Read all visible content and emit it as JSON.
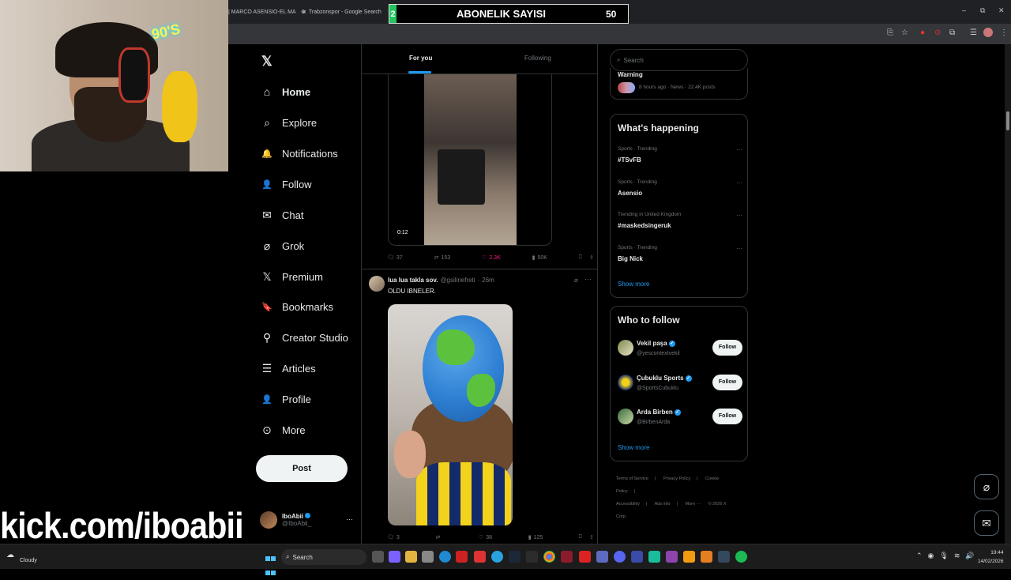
{
  "browser": {
    "tabs": [
      {
        "label": "| MARCO ASENSIO-EL MA",
        "close": "×"
      },
      {
        "label": "Trabzonspor - Google Search",
        "close": "×"
      }
    ],
    "window_controls": {
      "minimize": "–",
      "restore": "⧉",
      "close": "✕"
    }
  },
  "overlay": {
    "sub_counter": {
      "title": "ABONELIK SAYISI",
      "left_value": "2",
      "count": "50"
    },
    "kick_url": "kick.com/iboabii",
    "webcam_sign": "90'S"
  },
  "sidebar": {
    "logo": "𝕏",
    "items": [
      {
        "label": "Home",
        "icon": "home-icon",
        "glyph": "⌂"
      },
      {
        "label": "Explore",
        "icon": "search-icon",
        "glyph": "⌕"
      },
      {
        "label": "Notifications",
        "icon": "bell-icon",
        "glyph": "🔔"
      },
      {
        "label": "Follow",
        "icon": "person-plus-icon",
        "glyph": "👤"
      },
      {
        "label": "Chat",
        "icon": "mail-icon",
        "glyph": "✉"
      },
      {
        "label": "Grok",
        "icon": "grok-icon",
        "glyph": "⌀"
      },
      {
        "label": "Premium",
        "icon": "x-premium-icon",
        "glyph": "𝕏"
      },
      {
        "label": "Bookmarks",
        "icon": "bookmark-icon",
        "glyph": "🔖"
      },
      {
        "label": "Creator Studio",
        "icon": "creator-icon",
        "glyph": "⚲"
      },
      {
        "label": "Articles",
        "icon": "articles-icon",
        "glyph": "☰"
      },
      {
        "label": "Profile",
        "icon": "profile-icon",
        "glyph": "👤"
      },
      {
        "label": "More",
        "icon": "more-circle-icon",
        "glyph": "⊙"
      }
    ],
    "post_label": "Post",
    "profile": {
      "name": "IboAbii",
      "handle": "@IboAbii_",
      "more": "···"
    }
  },
  "timeline": {
    "tabs": {
      "for_you": "For you",
      "following": "Following"
    },
    "tweet1": {
      "video_duration": "0:12",
      "replies": "37",
      "reposts": "153",
      "likes": "2.3K",
      "views": "50K"
    },
    "tweet2": {
      "name": "lua lua takla sov.",
      "handle": "@gsilinefreti",
      "dot": "·",
      "time": "26m",
      "text": "OLDU IBNELER.",
      "replies": "3",
      "reposts": "",
      "likes": "38",
      "views": "125"
    }
  },
  "right": {
    "search_placeholder": "Search",
    "top_trend": {
      "title": "Warning",
      "meta": "8 hours ago · News · 22.4K posts"
    },
    "happening": {
      "title": "What's happening",
      "trends": [
        {
          "category": "Sports · Trending",
          "name": "#TSvFB"
        },
        {
          "category": "Sports · Trending",
          "name": "Asensio"
        },
        {
          "category": "Trending in United Kingdom",
          "name": "#maskedsingeruk"
        },
        {
          "category": "Sports · Trending",
          "name": "Big Nick"
        }
      ],
      "show_more": "Show more"
    },
    "who_to_follow": {
      "title": "Who to follow",
      "accounts": [
        {
          "name": "Vekil paşa",
          "handle": "@yescontextvekil",
          "button": "Follow"
        },
        {
          "name": "Çubuklu Sports",
          "handle": "@SportsCubuklu",
          "button": "Follow"
        },
        {
          "name": "Arda Birben",
          "handle": "@BirbenArda",
          "button": "Follow"
        }
      ],
      "show_more": "Show more"
    },
    "footer": {
      "links": [
        "Terms of Service",
        "|",
        "Privacy Policy",
        "|",
        "Cookie Policy",
        "|",
        "Accessibility",
        "|",
        "Ads info",
        "|",
        "More ···",
        "© 2026 X Corp."
      ]
    }
  },
  "taskbar": {
    "weather": "Cloudy",
    "search_label": "Search",
    "time": "19:44",
    "date": "14/02/2026"
  },
  "colors": {
    "accent": "#1d9bf0",
    "like": "#f91880",
    "counter_bar": "#22c55e"
  }
}
